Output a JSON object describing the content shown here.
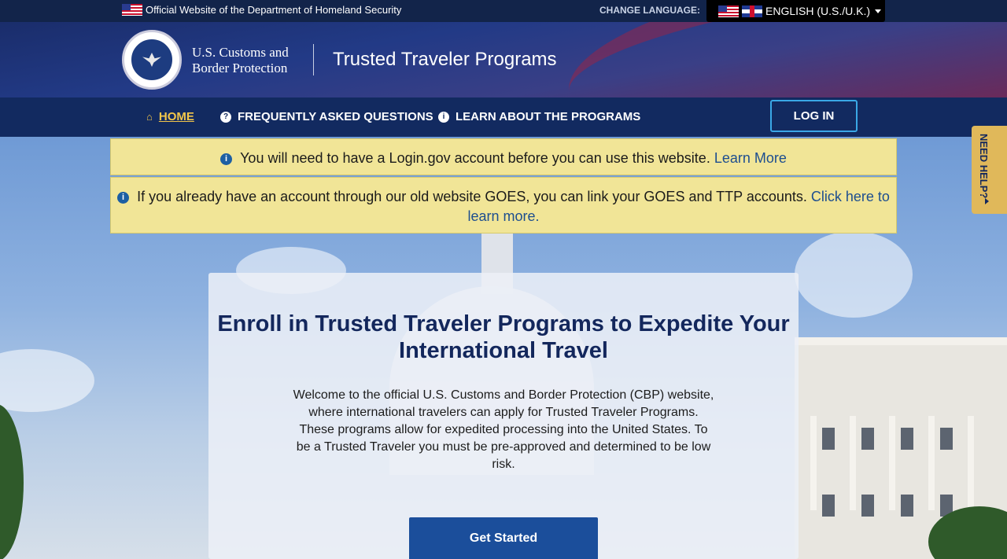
{
  "topbar": {
    "official_text": "Official Website of the Department of Homeland Security",
    "change_language_label": "CHANGE LANGUAGE:",
    "language_selected": "ENGLISH (U.S./U.K.)"
  },
  "header": {
    "agency_line1": "U.S. Customs and",
    "agency_line2": "Border Protection",
    "program_title": "Trusted Traveler Programs"
  },
  "nav": {
    "items": [
      {
        "label": "HOME",
        "icon": "home-icon"
      },
      {
        "label": "FREQUENTLY ASKED QUESTIONS",
        "icon": "question-circle-icon"
      },
      {
        "label": "LEARN ABOUT THE PROGRAMS",
        "icon": "info-circle-icon"
      }
    ],
    "login_label": "LOG IN"
  },
  "alerts": {
    "alert1_text": "You will need to have a Login.gov account before you can use this website.",
    "alert1_link": "Learn More",
    "alert2_text": "If you already have an account through our old website GOES, you can link your GOES and TTP accounts.",
    "alert2_link": "Click here to learn more."
  },
  "main": {
    "title": "Enroll in Trusted Traveler Programs to Expedite Your International Travel",
    "description": "Welcome to the official U.S. Customs and Border Protection (CBP) website, where international travelers can apply for Trusted Traveler Programs. These programs allow for expedited processing into the United States. To be a Trusted Traveler you must be pre-approved and determined to be low risk.",
    "cta_label": "Get Started"
  },
  "help_tab": {
    "label": "NEED HELP?"
  },
  "colors": {
    "nav_bg": "#122a60",
    "active_nav": "#f3c64a",
    "alert_bg": "#f1e597",
    "cta_bg": "#1b4e9b",
    "help_tab_bg": "#e0b85a"
  }
}
